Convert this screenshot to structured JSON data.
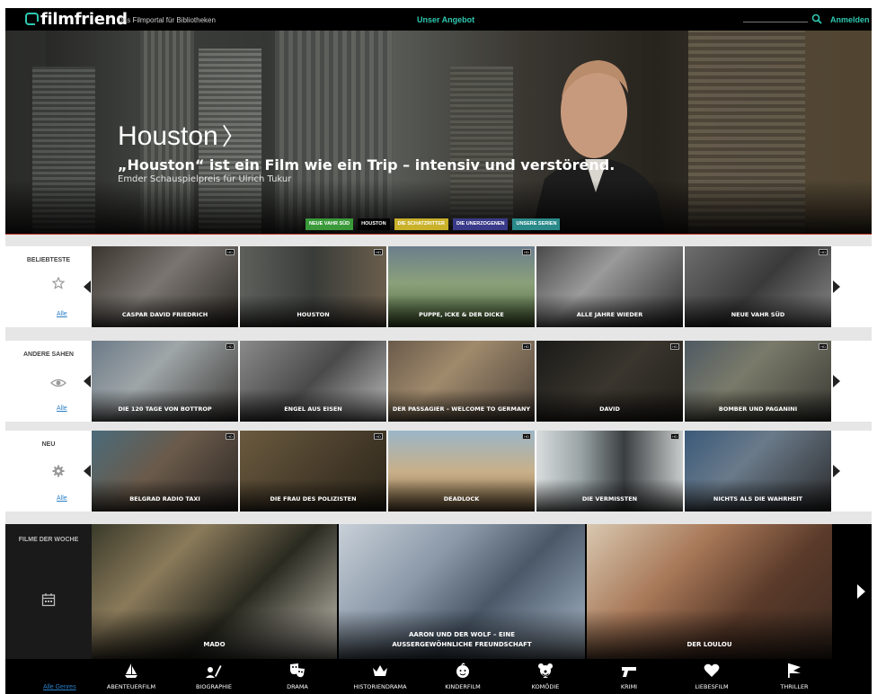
{
  "header": {
    "brand": "filmfriend",
    "tagline": "Das Filmportal für Bibliotheken",
    "offer_link": "Unser Angebot",
    "search_icon": "search-icon",
    "login": "Anmelden"
  },
  "hero": {
    "title": "Houston",
    "arrow": "〉",
    "subtitle": "„Houston“ ist ein Film wie ein Trip – intensiv und verstörend.",
    "caption": "Emder Schauspielpreis für Ulrich Tukur",
    "tabs": [
      {
        "label": "NEUE VAHR SÜD",
        "color": "#3a9a3a"
      },
      {
        "label": "HOUSTON",
        "color": "#000000"
      },
      {
        "label": "DIE SCHATZRITTER",
        "color": "#c9b12a"
      },
      {
        "label": "DIE UNERZOGENEN",
        "color": "#3a3a8a"
      },
      {
        "label": "UNSERE SERIEN",
        "color": "#2a8a8a"
      }
    ]
  },
  "rows": [
    {
      "label": "BELIEBTESTE",
      "icon": "star-icon",
      "all": "Alle",
      "items": [
        {
          "title": "CASPAR DAVID FRIEDRICH",
          "hd": "HD"
        },
        {
          "title": "HOUSTON",
          "hd": "HD"
        },
        {
          "title": "PUPPE, ICKE & DER DICKE",
          "hd": "HD"
        },
        {
          "title": "ALLE JAHRE WIEDER",
          "hd": ""
        },
        {
          "title": "NEUE VAHR SÜD",
          "hd": "HD"
        }
      ]
    },
    {
      "label": "ANDERE SAHEN",
      "icon": "eye-icon",
      "all": "Alle",
      "items": [
        {
          "title": "DIE 120 TAGE VON BOTTROP",
          "hd": "HD"
        },
        {
          "title": "ENGEL AUS EISEN",
          "hd": ""
        },
        {
          "title": "DER PASSAGIER – WELCOME TO GERMANY",
          "hd": "HD"
        },
        {
          "title": "DAVID",
          "hd": "HD"
        },
        {
          "title": "BOMBER UND PAGANINI",
          "hd": "HD"
        }
      ]
    },
    {
      "label": "NEU",
      "icon": "gear-icon",
      "all": "Alle",
      "items": [
        {
          "title": "BELGRAD RADIO TAXI",
          "hd": "HD"
        },
        {
          "title": "DIE FRAU DES POLIZISTEN",
          "hd": "HD"
        },
        {
          "title": "DEADLOCK",
          "hd": "HD"
        },
        {
          "title": "DIE VERMISSTEN",
          "hd": "HD"
        },
        {
          "title": "NICHTS ALS DIE WAHRHEIT",
          "hd": ""
        }
      ]
    }
  ],
  "weekly": {
    "label": "FILME DER WOCHE",
    "icon": "calendar-icon",
    "items": [
      {
        "title": "MADO"
      },
      {
        "title": "AARON UND DER WOLF – EINE AUSSERGEWÖHNLICHE FREUNDSCHAFT"
      },
      {
        "title": "DER LOULOU"
      }
    ]
  },
  "genres": {
    "all": "Alle Genres",
    "items": [
      {
        "label": "ABENTEUERFILM",
        "icon": "sailboat-icon"
      },
      {
        "label": "BIOGRAPHIE",
        "icon": "person-pen-icon"
      },
      {
        "label": "DRAMA",
        "icon": "theater-masks-icon"
      },
      {
        "label": "HISTORIENDRAMA",
        "icon": "crown-icon"
      },
      {
        "label": "KINDERFILM",
        "icon": "baby-face-icon"
      },
      {
        "label": "KOMÖDIE",
        "icon": "clown-icon"
      },
      {
        "label": "KRIMI",
        "icon": "pistol-icon"
      },
      {
        "label": "LIEBESFILM",
        "icon": "heart-icon"
      },
      {
        "label": "THRILLER",
        "icon": "flag-icon"
      }
    ]
  }
}
